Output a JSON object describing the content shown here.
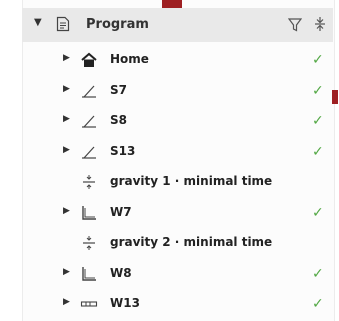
{
  "header": {
    "title": "Program"
  },
  "colors": {
    "accent": "#9e1f22",
    "check": "#53a845",
    "header_bg": "#e9e9e9"
  },
  "items": [
    {
      "label": "Home",
      "icon": "home-icon",
      "expandable": true,
      "checked": true
    },
    {
      "label": "S7",
      "icon": "angle-line-icon",
      "expandable": true,
      "checked": true
    },
    {
      "label": "S8",
      "icon": "angle-line-icon",
      "expandable": true,
      "checked": true
    },
    {
      "label": "S13",
      "icon": "angle-line-icon",
      "expandable": true,
      "checked": true
    },
    {
      "label": "gravity 1 · minimal time",
      "icon": "gravity-icon",
      "expandable": false,
      "checked": false
    },
    {
      "label": "W7",
      "icon": "corner-icon",
      "expandable": true,
      "checked": true
    },
    {
      "label": "gravity 2 · minimal time",
      "icon": "gravity-icon",
      "expandable": false,
      "checked": false
    },
    {
      "label": "W8",
      "icon": "corner-icon",
      "expandable": true,
      "checked": true
    },
    {
      "label": "W13",
      "icon": "bar-icon",
      "expandable": true,
      "checked": true
    }
  ]
}
